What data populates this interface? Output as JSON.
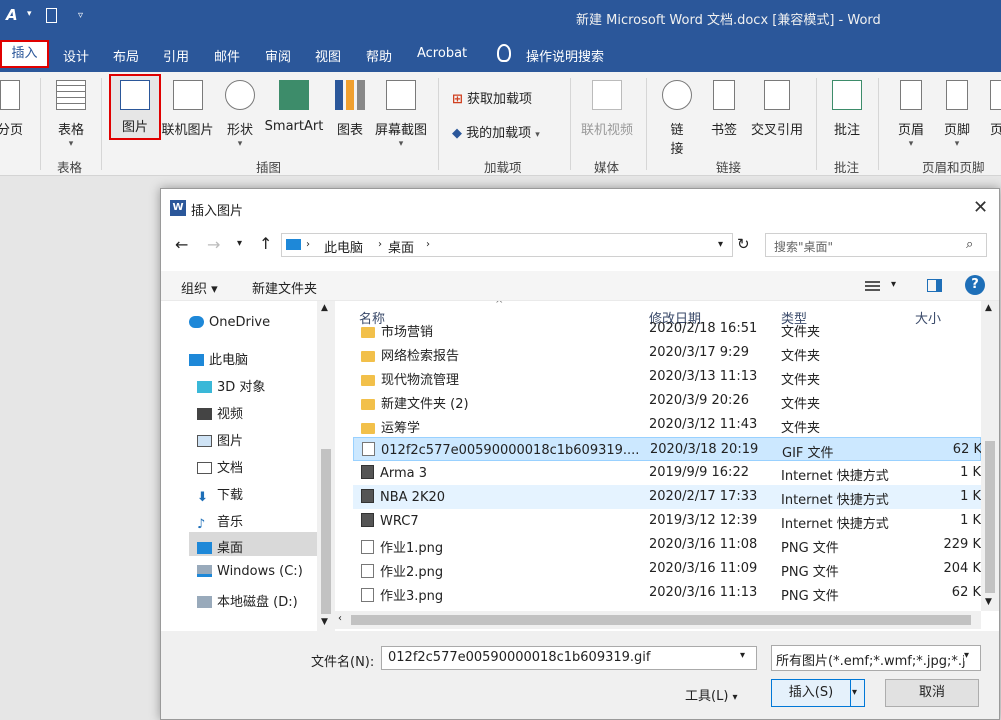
{
  "window": {
    "title": "新建 Microsoft Word 文档.docx [兼容模式] - Word"
  },
  "tabs": [
    "插入",
    "设计",
    "布局",
    "引用",
    "邮件",
    "审阅",
    "视图",
    "帮助",
    "Acrobat"
  ],
  "tell_me": "操作说明搜索",
  "ribbon": {
    "pages_label": "分页",
    "table_label": "表格",
    "picture_label": "图片",
    "online_picture_label": "联机图片",
    "shapes_label": "形状",
    "smartart_label": "SmartArt",
    "chart_label": "图表",
    "screenshot_label": "屏幕截图",
    "get_addins_label": "获取加载项",
    "my_addins_label": "我的加载项",
    "online_video_label": "联机视频",
    "link_label_1": "链",
    "link_label_2": "接",
    "bookmark_label": "书签",
    "crossref_label": "交叉引用",
    "comment_label": "批注",
    "header_label": "页眉",
    "footer_label": "页脚",
    "pagenum_label": "页",
    "groups": {
      "tables": "表格",
      "illustrations": "插图",
      "addins": "加载项",
      "media": "媒体",
      "links": "链接",
      "comments": "批注",
      "header_footer": "页眉和页脚"
    }
  },
  "dialog": {
    "title": "插入图片",
    "breadcrumb": [
      "此电脑",
      "桌面"
    ],
    "search_placeholder": "搜索\"桌面\"",
    "organize_label": "组织 ▾",
    "new_folder_label": "新建文件夹",
    "nav": {
      "onedrive": "OneDrive",
      "this_pc": "此电脑",
      "objects3d": "3D 对象",
      "videos": "视频",
      "pictures": "图片",
      "documents": "文档",
      "downloads": "下载",
      "music": "音乐",
      "desktop": "桌面",
      "windows_c": "Windows (C:)",
      "local_d": "本地磁盘 (D:)"
    },
    "columns": {
      "name": "名称",
      "date": "修改日期",
      "type": "类型",
      "size": "大小"
    },
    "files": [
      {
        "name": "市场营销",
        "date": "2020/2/18 16:51",
        "type": "文件夹",
        "size": ""
      },
      {
        "name": "网络检索报告",
        "date": "2020/3/17 9:29",
        "type": "文件夹",
        "size": ""
      },
      {
        "name": "现代物流管理",
        "date": "2020/3/13 11:13",
        "type": "文件夹",
        "size": ""
      },
      {
        "name": "新建文件夹 (2)",
        "date": "2020/3/9 20:26",
        "type": "文件夹",
        "size": ""
      },
      {
        "name": "运筹学",
        "date": "2020/3/12 11:43",
        "type": "文件夹",
        "size": ""
      },
      {
        "name": "012f2c577e00590000018c1b609319....",
        "date": "2020/3/18 20:19",
        "type": "GIF 文件",
        "size": "62 K"
      },
      {
        "name": "Arma 3",
        "date": "2019/9/9 16:22",
        "type": "Internet 快捷方式",
        "size": "1 K"
      },
      {
        "name": "NBA 2K20",
        "date": "2020/2/17 17:33",
        "type": "Internet 快捷方式",
        "size": "1 K"
      },
      {
        "name": "WRC7",
        "date": "2019/3/12 12:39",
        "type": "Internet 快捷方式",
        "size": "1 K"
      },
      {
        "name": "作业1.png",
        "date": "2020/3/16 11:08",
        "type": "PNG 文件",
        "size": "229 K"
      },
      {
        "name": "作业2.png",
        "date": "2020/3/16 11:09",
        "type": "PNG 文件",
        "size": "204 K"
      },
      {
        "name": "作业3.png",
        "date": "2020/3/16 11:13",
        "type": "PNG 文件",
        "size": "62 K"
      }
    ],
    "filename_label": "文件名(N):",
    "filename_value": "012f2c577e00590000018c1b609319.gif",
    "filter_value": "所有图片(*.emf;*.wmf;*.jpg;*.j",
    "tools_label": "工具(L)",
    "insert_label": "插入(S)",
    "cancel_label": "取消"
  },
  "colors": {
    "brand": "#2b579a",
    "highlight_red": "#e00000",
    "selection": "#cce8ff",
    "hover": "#e5f3ff"
  }
}
